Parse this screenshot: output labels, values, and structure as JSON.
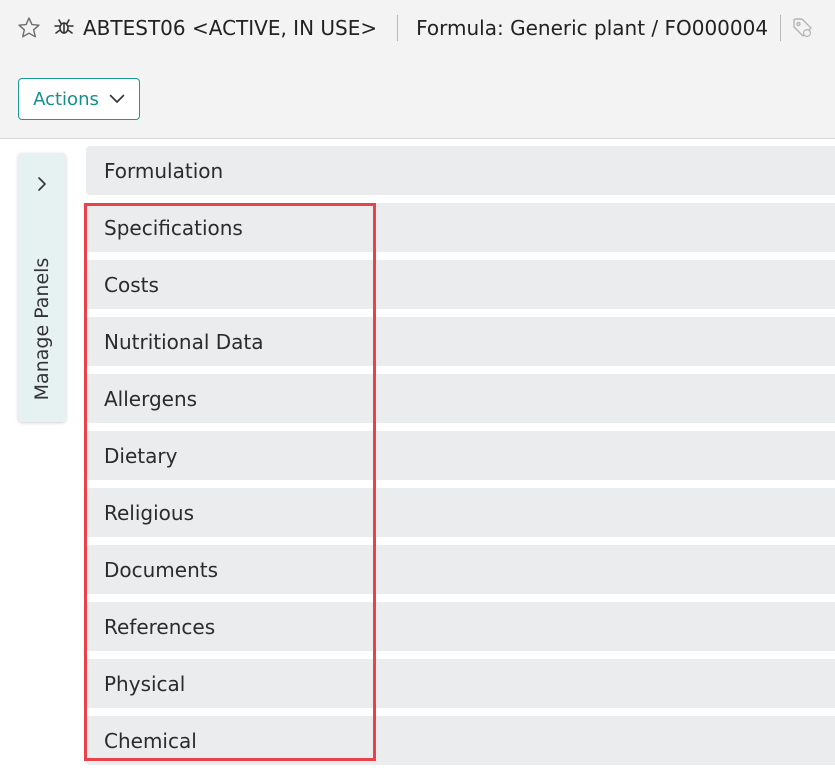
{
  "header": {
    "record_title": "ABTEST06 <ACTIVE, IN USE>",
    "formula_label": "Formula: Generic plant / FO000004",
    "icons": [
      "star-icon",
      "bug-icon",
      "tag-icon"
    ]
  },
  "toolbar": {
    "actions_label": "Actions",
    "actions_icon": "chevron-down-icon"
  },
  "sidebar": {
    "manage_panels_label": "Manage Panels",
    "expand_icon": "chevron-right-icon"
  },
  "panels": [
    {
      "label": "Formulation"
    },
    {
      "label": "Specifications"
    },
    {
      "label": "Costs"
    },
    {
      "label": "Nutritional Data"
    },
    {
      "label": "Allergens"
    },
    {
      "label": "Dietary"
    },
    {
      "label": "Religious"
    },
    {
      "label": "Documents"
    },
    {
      "label": "References"
    },
    {
      "label": "Physical"
    },
    {
      "label": "Chemical"
    }
  ],
  "colors": {
    "accent": "#1a9a93",
    "highlight": "#e8434b",
    "panel_bg": "#eaeced",
    "topbar_bg": "#f3f3f3"
  }
}
